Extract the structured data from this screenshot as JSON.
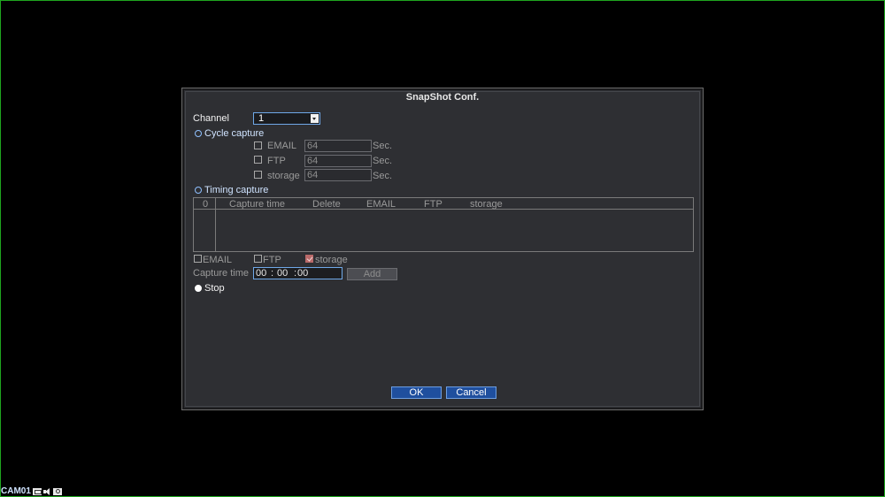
{
  "dialog": {
    "title": "SnapShot Conf."
  },
  "channel": {
    "label": "Channel",
    "value": "1"
  },
  "cycle_capture": {
    "label": "Cycle capture",
    "selected": false,
    "rows": [
      {
        "label": "EMAIL",
        "checked": false,
        "value": "64",
        "unit": "Sec."
      },
      {
        "label": "FTP",
        "checked": false,
        "value": "64",
        "unit": "Sec."
      },
      {
        "label": "storage",
        "checked": false,
        "value": "64",
        "unit": "Sec."
      }
    ]
  },
  "timing_capture": {
    "label": "Timing capture",
    "selected": false,
    "columns": [
      "0",
      "Capture time",
      "Delete",
      "EMAIL",
      "FTP",
      "storage"
    ],
    "rows": [],
    "options": [
      {
        "label": "EMAIL",
        "checked": false
      },
      {
        "label": "FTP",
        "checked": false
      },
      {
        "label": "storage",
        "checked": true
      }
    ],
    "capture_time_label": "Capture time",
    "capture_time": {
      "hh": "00",
      "sep1": ":",
      "mm": "00",
      "sep2": ":",
      "ss": "00"
    },
    "add_label": "Add"
  },
  "stop": {
    "label": "Stop",
    "selected": true
  },
  "buttons": {
    "ok": "OK",
    "cancel": "Cancel"
  },
  "status_bar": {
    "camera_name": "CAM01",
    "icons": [
      "record-icon",
      "mute-icon",
      "camera-icon"
    ]
  },
  "colors": {
    "background": "#000000",
    "dialog": "#2e2f33",
    "accent_blue": "#1f4f9e",
    "frame_green": "#1fa51f"
  }
}
